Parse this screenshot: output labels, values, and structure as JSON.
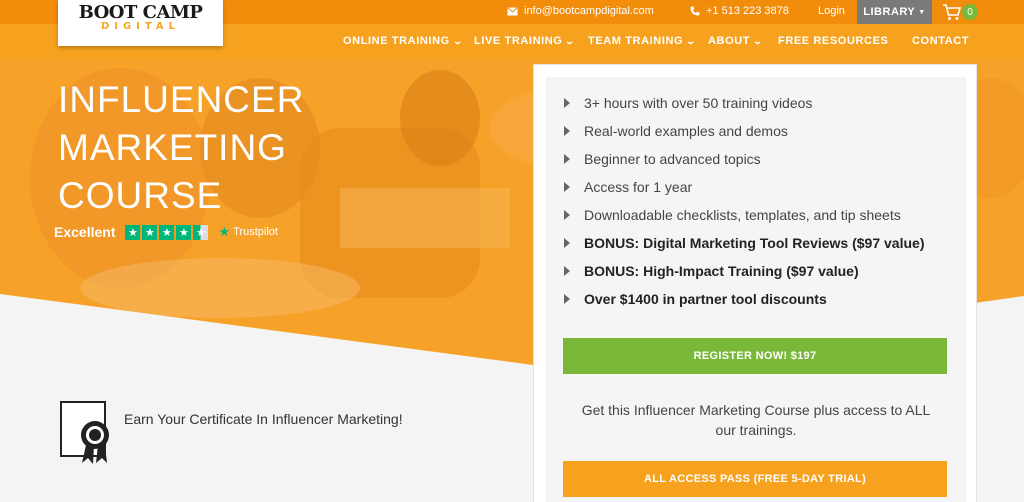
{
  "topbar": {
    "email": "info@bootcampdigital.com",
    "phone": "+1 513 223 3878",
    "login": "Login",
    "library": "LIBRARY",
    "cart_count": "0"
  },
  "logo": {
    "line1": "BOOT CAMP",
    "line2": "DIGITAL"
  },
  "nav": {
    "items": [
      {
        "label": "ONLINE TRAINING",
        "has_dropdown": true
      },
      {
        "label": "LIVE TRAINING",
        "has_dropdown": true
      },
      {
        "label": "TEAM TRAINING",
        "has_dropdown": true
      },
      {
        "label": "ABOUT",
        "has_dropdown": true
      },
      {
        "label": "FREE RESOURCES",
        "has_dropdown": false
      },
      {
        "label": "CONTACT",
        "has_dropdown": false
      }
    ]
  },
  "hero": {
    "title": [
      "INFLUENCER",
      "MARKETING",
      "COURSE"
    ],
    "rating_label": "Excellent",
    "rating_stars": 4.5,
    "trustpilot": "Trustpilot"
  },
  "certificate": {
    "text": "Earn Your Certificate In Influencer Marketing!"
  },
  "card": {
    "features": [
      {
        "text": "3+ hours with over 50 training videos",
        "bold": false
      },
      {
        "text": "Real-world examples and demos",
        "bold": false
      },
      {
        "text": "Beginner to advanced topics",
        "bold": false
      },
      {
        "text": "Access for 1 year",
        "bold": false
      },
      {
        "text": "Downloadable checklists, templates, and tip sheets",
        "bold": false
      },
      {
        "text": "BONUS: Digital Marketing Tool Reviews ($97 value)",
        "bold": true
      },
      {
        "text": "BONUS: High-Impact Training ($97 value)",
        "bold": true
      },
      {
        "text": "Over $1400 in partner tool discounts",
        "bold": true
      }
    ],
    "register_button": "REGISTER NOW! $197",
    "access_text": "Get this Influencer Marketing Course plus access to ALL our trainings.",
    "access_button": "ALL ACCESS PASS (FREE 5-DAY TRIAL)"
  },
  "colors": {
    "brand_orange": "#f7a21e",
    "topbar_orange": "#f28c0b",
    "green": "#7ab83a",
    "trustpilot_green": "#00b67a"
  }
}
